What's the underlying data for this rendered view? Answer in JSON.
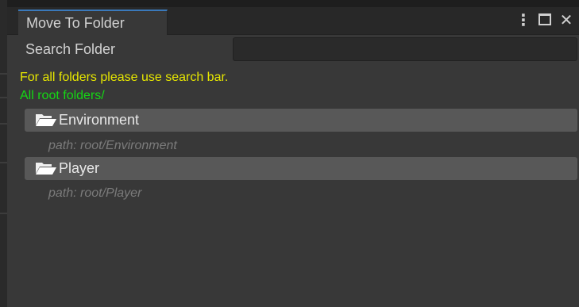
{
  "window": {
    "tab_title": "Move To Folder"
  },
  "search": {
    "label": "Search Folder",
    "value": "",
    "placeholder": ""
  },
  "hint": "For all folders please use search bar.",
  "root_path": "All root folders/",
  "folders": [
    {
      "name": "Environment",
      "path": "path: root/Environment"
    },
    {
      "name": "Player",
      "path": "path: root/Player"
    }
  ],
  "colors": {
    "hint": "#e6e600",
    "root_path": "#14d814",
    "tab_accent": "#3a79bb"
  },
  "icons": {
    "folder": "folder-open-icon",
    "more": "kebab-menu-icon",
    "maximize": "maximize-icon",
    "close": "close-icon"
  }
}
